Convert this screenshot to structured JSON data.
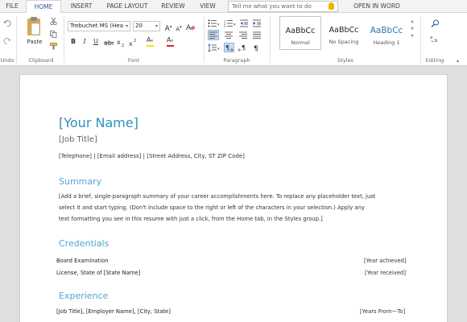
{
  "tabs": [
    "FILE",
    "HOME",
    "INSERT",
    "PAGE LAYOUT",
    "REVIEW",
    "VIEW",
    "OPEN IN WORD"
  ],
  "tell_me": {
    "placeholder": "Tell me what you want to do"
  },
  "ribbon": {
    "groups": {
      "undo": "Undo",
      "clipboard": "Clipboard",
      "font": "Font",
      "paragraph": "Paragraph",
      "styles": "Styles",
      "editing": "Editing"
    },
    "paste_label": "Paste",
    "font_name": "Trebuchet MS (Hea",
    "font_size": "20",
    "bold": "B",
    "italic": "I",
    "underline": "U",
    "grow_font": "A",
    "shrink_font": "A",
    "highlight": "A",
    "font_color": "A",
    "styles": [
      {
        "sample": "AaBbCc",
        "name": "Normal"
      },
      {
        "sample": "AaBbCc",
        "name": "No Spacing"
      },
      {
        "sample": "AaBbCc",
        "name": "Heading 1"
      }
    ]
  },
  "document": {
    "name": "[Your Name]",
    "job_title": "[Job Title]",
    "contact": "[Telephone]  |  [Email address]   |  [Street Address, City, ST ZIP Code]",
    "summary_heading": "Summary",
    "summary_lines": [
      "[Add a brief, single-paragraph summary of your career accomplishments here. To replace any placeholder text, just",
      "select it and start typing. (Don't include space to the right or left of the characters in your selection.) Apply any",
      "text formatting you see in this resume with just a click, from the Home tab, in the Styles group.]"
    ],
    "credentials_heading": "Credentials",
    "credentials": [
      {
        "left": "Board Examination",
        "right": "[Year achieved]"
      },
      {
        "left": "License, State of [State Name]",
        "right": "[Year received]"
      }
    ],
    "experience_heading": "Experience",
    "experience": [
      {
        "left": "[Job Title], [Employer Name], [City, State]",
        "right": "[Years From—To]"
      }
    ]
  },
  "colors": {
    "accent": "#2b579a",
    "name": "#2e8fbf",
    "heading": "#4ea5cf",
    "heading1_style": "#2e74b5"
  }
}
